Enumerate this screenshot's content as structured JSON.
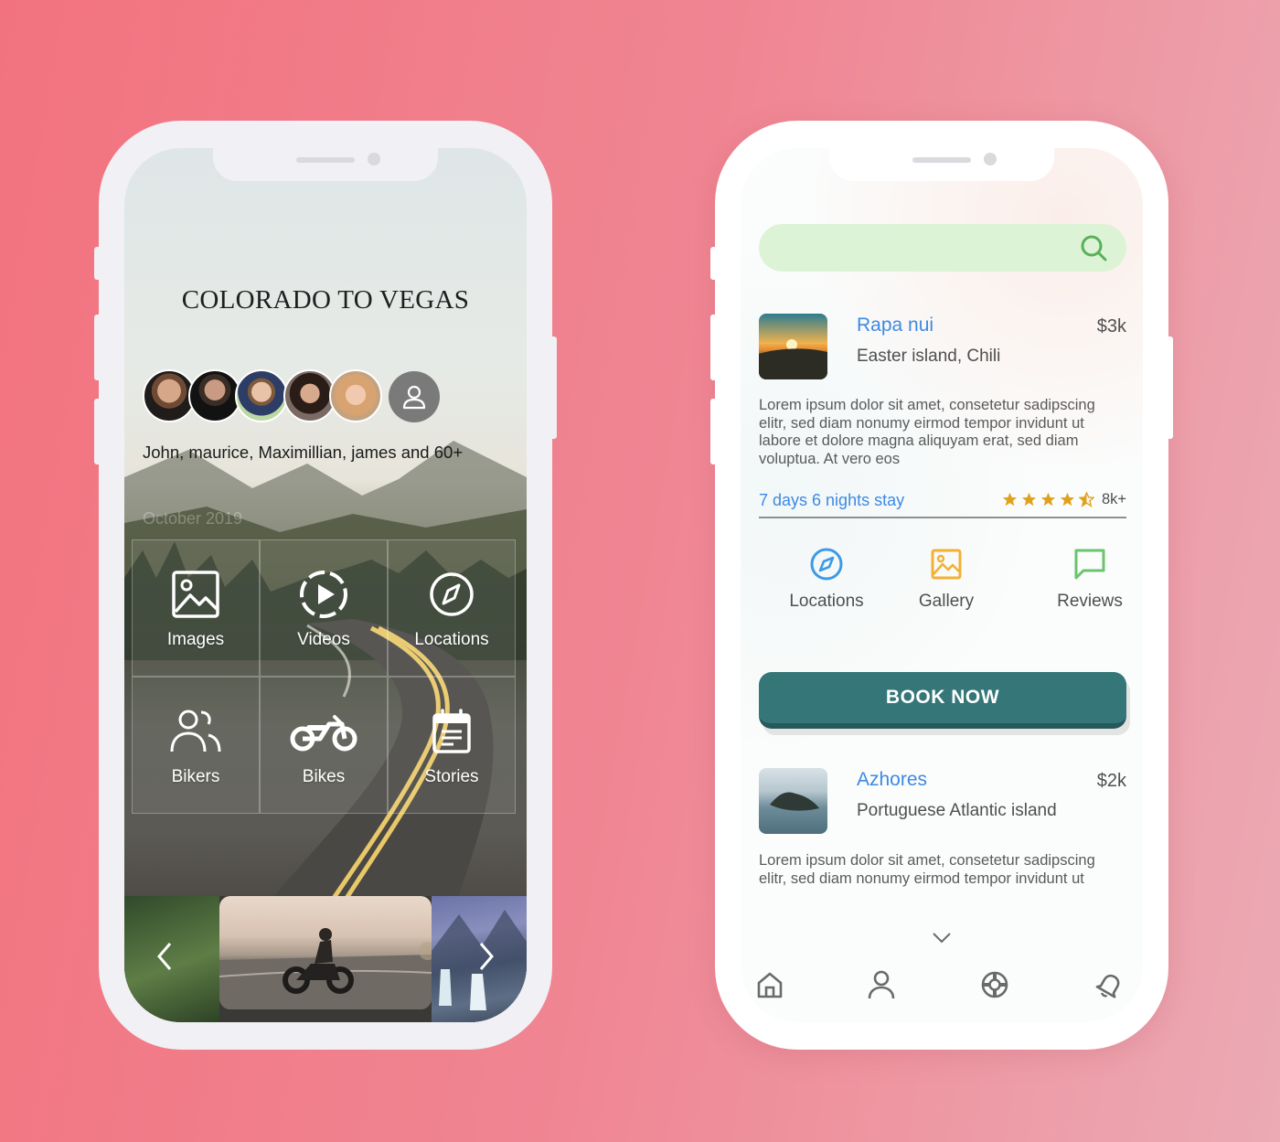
{
  "left_app": {
    "trip_title": "COLORADO TO VEGAS",
    "attendees_text": "John, maurice, Maximillian, james and 60+",
    "date_label": "October 2019",
    "tiles": [
      {
        "label": "Images",
        "icon": "image-icon"
      },
      {
        "label": "Videos",
        "icon": "play-circle-icon"
      },
      {
        "label": "Locations",
        "icon": "compass-icon"
      },
      {
        "label": "Bikers",
        "icon": "users-icon"
      },
      {
        "label": "Bikes",
        "icon": "motorcycle-icon"
      },
      {
        "label": "Stories",
        "icon": "calendar-icon"
      }
    ]
  },
  "right_app": {
    "destinations": [
      {
        "title": "Rapa nui",
        "subtitle": "Easter island, Chili",
        "price": "$3k",
        "description": "Lorem ipsum dolor sit amet, consetetur sadipscing elitr, sed diam nonumy eirmod tempor invidunt ut labore et dolore magna aliquyam erat, sed diam voluptua. At vero eos"
      },
      {
        "title": "Azhores",
        "subtitle": "Portuguese Atlantic island",
        "price": "$2k",
        "description": "Lorem ipsum dolor sit amet, consetetur sadipscing elitr, sed diam nonumy eirmod tempor invidunt ut"
      }
    ],
    "stay_text": "7 days 6 nights stay",
    "rating": {
      "stars": 4.5,
      "count": "8k+"
    },
    "actions": [
      {
        "label": "Locations",
        "icon": "compass-icon",
        "color": "#3d9ae8"
      },
      {
        "label": "Gallery",
        "icon": "image-icon",
        "color": "#f2b134"
      },
      {
        "label": "Reviews",
        "icon": "chat-icon",
        "color": "#6cc36e"
      }
    ],
    "book_button": "BOOK NOW",
    "nav": [
      "home-icon",
      "user-icon",
      "lifebuoy-icon",
      "bell-icon"
    ],
    "colors": {
      "accent_blue": "#3d8ae2",
      "search_bg": "#ddf3d5",
      "book_bg": "#357678",
      "star": "#e0a21c"
    }
  }
}
